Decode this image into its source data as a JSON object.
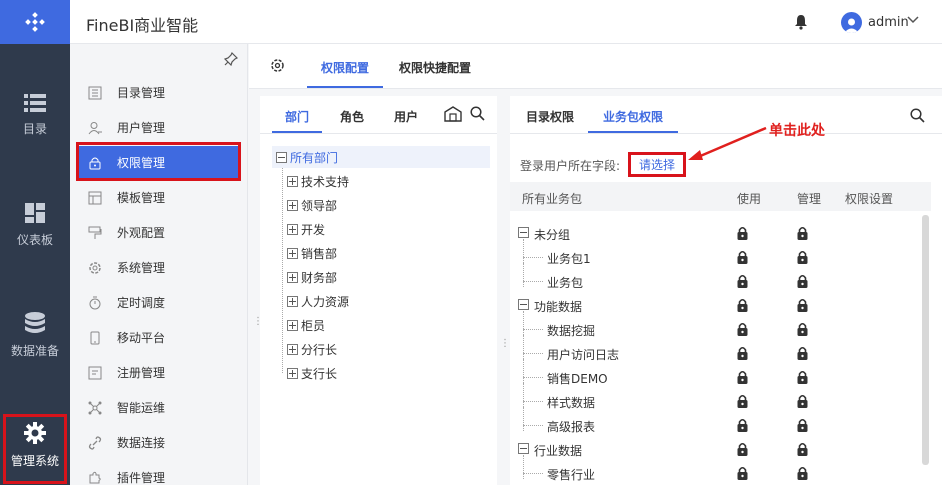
{
  "app": {
    "title": "FineBI商业智能"
  },
  "header": {
    "username": "admin"
  },
  "rail": [
    {
      "label": "目录",
      "icon": "list-icon"
    },
    {
      "label": "仪表板",
      "icon": "dashboard-icon"
    },
    {
      "label": "数据准备",
      "icon": "database-icon"
    },
    {
      "label": "管理系统",
      "icon": "gear-icon"
    }
  ],
  "sidebar": {
    "items": [
      {
        "label": "目录管理",
        "icon": "catalog-icon"
      },
      {
        "label": "用户管理",
        "icon": "user-icon"
      },
      {
        "label": "权限管理",
        "icon": "lock-icon"
      },
      {
        "label": "模板管理",
        "icon": "template-icon"
      },
      {
        "label": "外观配置",
        "icon": "brush-icon"
      },
      {
        "label": "系统管理",
        "icon": "settings-icon"
      },
      {
        "label": "定时调度",
        "icon": "timer-icon"
      },
      {
        "label": "移动平台",
        "icon": "mobile-icon"
      },
      {
        "label": "注册管理",
        "icon": "register-icon"
      },
      {
        "label": "智能运维",
        "icon": "ops-icon"
      },
      {
        "label": "数据连接",
        "icon": "link-icon"
      },
      {
        "label": "插件管理",
        "icon": "plugin-icon"
      }
    ]
  },
  "main": {
    "tabs": [
      {
        "label": "权限配置"
      },
      {
        "label": "权限快捷配置"
      }
    ]
  },
  "left_panel": {
    "tabs": [
      {
        "label": "部门"
      },
      {
        "label": "角色"
      },
      {
        "label": "用户"
      }
    ],
    "root": "所有部门",
    "departments": [
      "技术支持",
      "领导部",
      "开发",
      "销售部",
      "财务部",
      "人力资源",
      "柜员",
      "分行长",
      "支行长"
    ]
  },
  "right_panel": {
    "tabs": [
      {
        "label": "目录权限"
      },
      {
        "label": "业务包权限"
      }
    ],
    "field_label": "登录用户所在字段:",
    "select_label": "请选择",
    "columns": {
      "name": "所有业务包",
      "use": "使用",
      "manage": "管理",
      "settings": "权限设置"
    },
    "rows": [
      {
        "label": "未分组",
        "level": 0
      },
      {
        "label": "业务包1",
        "level": 1
      },
      {
        "label": "业务包",
        "level": 1
      },
      {
        "label": "功能数据",
        "level": 0
      },
      {
        "label": "数据挖掘",
        "level": 1
      },
      {
        "label": "用户访问日志",
        "level": 1
      },
      {
        "label": "销售DEMO",
        "level": 1
      },
      {
        "label": "样式数据",
        "level": 1
      },
      {
        "label": "高级报表",
        "level": 1
      },
      {
        "label": "行业数据",
        "level": 0
      },
      {
        "label": "零售行业",
        "level": 1
      }
    ]
  },
  "annotation": {
    "text": "单击此处"
  },
  "colors": {
    "accent": "#3f6ae0",
    "rail": "#2f3a4c",
    "highlight": "#d8131b"
  }
}
